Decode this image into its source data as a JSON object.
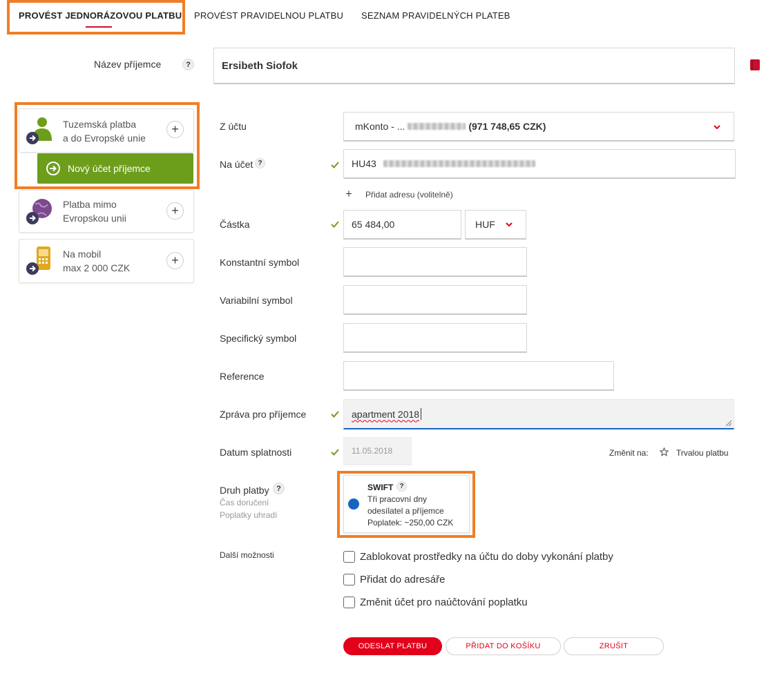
{
  "tabs": [
    {
      "label": "PROVÉST JEDNORÁZOVOU PLATBU",
      "active": true
    },
    {
      "label": "PROVÉST PRAVIDELNOU PLATBU",
      "active": false
    },
    {
      "label": "SEZNAM PRAVIDELNÝCH PLATEB",
      "active": false
    }
  ],
  "recipient": {
    "label": "Název příjemce",
    "help": "?",
    "value": "Ersibeth Siofok",
    "addressbook_icon": "addressbook-icon"
  },
  "sidebar": {
    "items": [
      {
        "line1": "Tuzemská platba",
        "line2": "a do Evropské unie",
        "icon": "person-icon",
        "plus": "+"
      },
      {
        "line1": "Platba mimo",
        "line2": "Evropskou unii",
        "icon": "globe-icon",
        "plus": "+"
      },
      {
        "line1": "Na mobil",
        "line2": "max 2 000 CZK",
        "icon": "mobile-icon",
        "plus": "+"
      }
    ],
    "new_account_button": "Nový účet příjemce"
  },
  "form": {
    "from_account": {
      "label": "Z účtu",
      "prefix": "mKonto - ...",
      "balance": "(971 748,65 CZK)"
    },
    "to_account": {
      "label": "Na účet",
      "help": "?",
      "prefix": "HU43"
    },
    "add_address": {
      "icon": "+",
      "label": "Přidat adresu (volitelně)"
    },
    "amount": {
      "label": "Částka",
      "value": "65 484,00",
      "currency": "HUF"
    },
    "constant_symbol": {
      "label": "Konstantní symbol",
      "value": ""
    },
    "variable_symbol": {
      "label": "Variabilní symbol",
      "value": ""
    },
    "specific_symbol": {
      "label": "Specifický symbol",
      "value": ""
    },
    "reference": {
      "label": "Reference",
      "value": ""
    },
    "message": {
      "label": "Zpráva pro příjemce",
      "value": "apartment 2018"
    },
    "due_date": {
      "label": "Datum splatnosti",
      "value": "11.05.2018",
      "change_to_label": "Změnit na:",
      "recurring_label": "Trvalou platbu"
    },
    "payment_type": {
      "label": "Druh platby",
      "help": "?",
      "sub1": "Čas doručení",
      "sub2": "Poplatky uhradí",
      "option_title": "SWIFT",
      "option_help": "?",
      "option_line1": "Tři pracovní dny",
      "option_line2": "odesílatel a příjemce",
      "option_line3": "Poplatek: ~250,00 CZK"
    },
    "more_options": {
      "label": "Další možnosti",
      "checkboxes": [
        "Zablokovat prostředky na účtu do doby vykonání platby",
        "Přidat do adresáře",
        "Změnit účet pro naúčtování poplatku"
      ]
    }
  },
  "actions": {
    "submit": "ODESLAT PLATBU",
    "add_to_cart": "PŘIDAT DO KOŠÍKU",
    "cancel": "ZRUŠIT"
  },
  "colors": {
    "accent_red": "#e2001a",
    "highlight_orange": "#f07e26",
    "green": "#6c9e1c",
    "check_green": "#6c9e1c",
    "radio_blue": "#1565c0"
  }
}
